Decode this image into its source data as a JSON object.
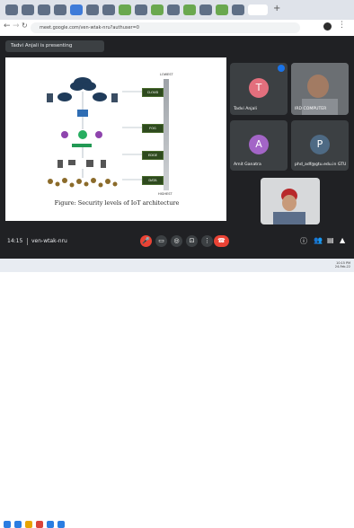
{
  "browser": {
    "url": "meet.google.com/ven-wtak-nru?authuser=0"
  },
  "meet": {
    "presenter_banner": "Tadvi Anjali is presenting",
    "slide": {
      "caption": "Figure: Security levels of IoT architecture",
      "layers": [
        "CLOUD",
        "FOG",
        "EDGE",
        "DATA"
      ],
      "top_label": "LOWEST",
      "bottom_label": "HIGHEST"
    },
    "participants": [
      {
        "name": "Tadvi Anjali",
        "initial": "T",
        "color": "#e36f7d"
      },
      {
        "name": "IRD COMPUTER",
        "initial": "",
        "color": "#7a7f86"
      },
      {
        "name": "Amit Ganatra",
        "initial": "A",
        "color": "#a365c7"
      },
      {
        "name": "phd_adf@gtu.edu.in GTU",
        "initial": "P",
        "color": "#4e6a84"
      }
    ],
    "time": "14:15",
    "meeting_code": "ven-wtak-nru"
  },
  "taskbar": {
    "time": "10:15 PM",
    "date": "24-Feb-22"
  }
}
